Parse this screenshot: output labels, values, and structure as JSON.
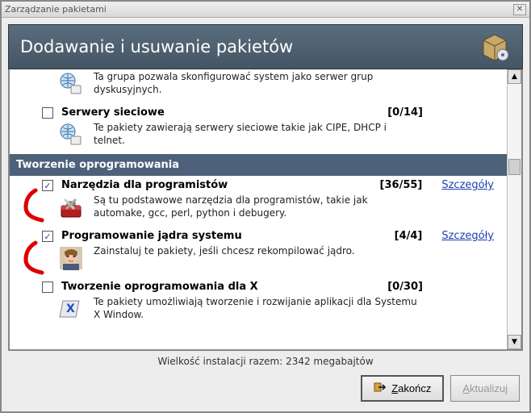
{
  "window": {
    "title": "Zarządzanie pakietami"
  },
  "banner": {
    "title": "Dodawanie i usuwanie pakietów"
  },
  "groups": {
    "partial_item_a": {
      "desc": "Ta grupa pozwala skonfigurować system jako serwer grup dyskusyjnych."
    },
    "serwery_sieciowe": {
      "label": "Serwery sieciowe",
      "count": "[0/14]",
      "desc": "Te pakiety zawierają serwery sieciowe takie jak CIPE, DHCP i telnet."
    },
    "section_header": "Tworzenie oprogramowania",
    "narzedzia": {
      "label": "Narzędzia dla programistów",
      "count": "[36/55]",
      "details": "Szczegóły",
      "desc": "Są tu podstawowe narzędzia dla programistów, takie jak automake, gcc, perl, python i debugery."
    },
    "jadro": {
      "label": "Programowanie jądra systemu",
      "count": "[4/4]",
      "details": "Szczegóły",
      "desc": "Zainstaluj te pakiety, jeśli chcesz rekompilować jądro."
    },
    "x": {
      "label": "Tworzenie oprogramowania dla X",
      "count": "[0/30]",
      "desc": "Te pakiety umożliwiają tworzenie i rozwijanie aplikacji dla Systemu X Window."
    }
  },
  "footer": {
    "status": "Wielkość instalacji razem: 2342 megabajtów"
  },
  "buttons": {
    "close_first": "Z",
    "close_rest": "akończ",
    "update_first": "A",
    "update_rest": "ktualizuj"
  }
}
